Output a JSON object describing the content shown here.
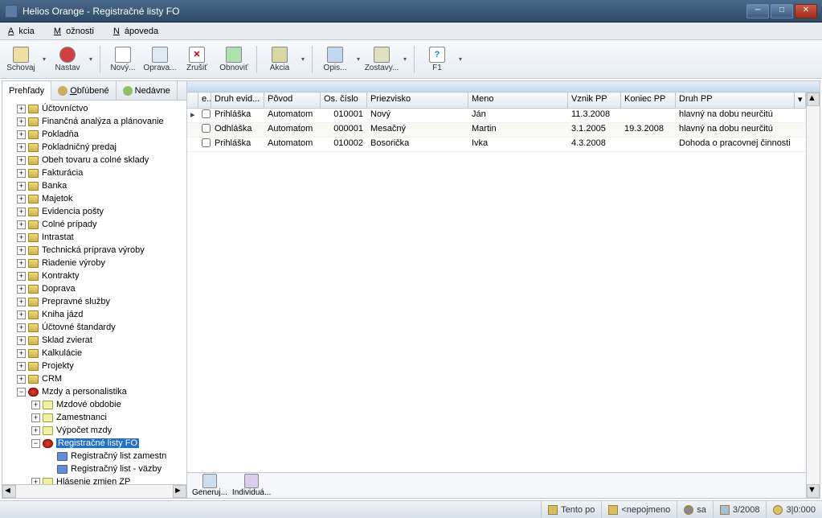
{
  "title": "Helios Orange - Registračné listy FO",
  "menu": {
    "akcia": "Akcia",
    "moznosti": "Možnosti",
    "napoveda": "Nápoveda"
  },
  "toolbar": {
    "schovaj": "Schovaj",
    "nastav": "Nastav",
    "novy": "Nový...",
    "oprava": "Oprava...",
    "zrusit": "Zrušiť",
    "obnovit": "Obnoviť",
    "akcia": "Akcia",
    "opis": "Opis...",
    "zostavy": "Zostavy...",
    "f1": "F1"
  },
  "side_tabs": {
    "prehlady": "Prehľady",
    "oblubene": "Obľúbené",
    "nedavne": "Nedávne"
  },
  "tree": {
    "uctovnictvo": "Účtovníctvo",
    "fap": "Finančná analýza a plánovanie",
    "pokladna": "Pokladňa",
    "pp": "Pokladničný predaj",
    "obeh": "Obeh tovaru a colné sklady",
    "fakt": "Fakturácia",
    "banka": "Banka",
    "majetok": "Majetok",
    "evidencia": "Evidencia pošty",
    "colne": "Colné prípady",
    "intrastat": "Intrastat",
    "tpv": "Technická príprava výroby",
    "riadenie": "Riadenie výroby",
    "kontrakty": "Kontrakty",
    "doprava": "Doprava",
    "prepravne": "Prepravné služby",
    "kniha": "Kniha jázd",
    "standardy": "Účtovné štandardy",
    "sklad": "Sklad zvierat",
    "kalk": "Kalkulácie",
    "projekty": "Projekty",
    "crm": "CRM",
    "mzdy": "Mzdy a personalistika",
    "mzdove": "Mzdové obdobie",
    "zamestnanci": "Zamestnanci",
    "vypocet": "Výpočet mzdy",
    "reg_fo": "Registračné listy FO",
    "reg_zam": "Registračný list zamestn",
    "reg_vazby": "Registračný list - väzby",
    "hlasenie": "Hlásenie zmien ZP"
  },
  "grid": {
    "headers": {
      "e": "e..",
      "druh_evid": "Druh evid...",
      "povod": "Pôvod",
      "os_cislo": "Os. číslo",
      "priezvisko": "Priezvisko",
      "meno": "Meno",
      "vznik": "Vznik PP",
      "koniec": "Koniec PP",
      "druh_pp": "Druh PP"
    },
    "rows": [
      {
        "druh": "Prihláška",
        "povod": "Automatom",
        "os": "010001",
        "priez": "Nový",
        "meno": "Ján",
        "vznik": "11.3.2008",
        "koniec": "",
        "druhpp": "hlavný na dobu neurčitú"
      },
      {
        "druh": "Odhláška",
        "povod": "Automatom",
        "os": "000001",
        "priez": "Mesačný",
        "meno": "Martin",
        "vznik": "3.1.2005",
        "koniec": "19.3.2008",
        "druhpp": "hlavný na dobu neurčitú"
      },
      {
        "druh": "Prihláška",
        "povod": "Automatom",
        "os": "010002",
        "priez": "Bosorička",
        "meno": "Ivka",
        "vznik": "4.3.2008",
        "koniec": "",
        "druhpp": "Dohoda o pracovnej činnosti"
      }
    ]
  },
  "bottom_buttons": {
    "generuj": "Generuj...",
    "individ": "Individuá..."
  },
  "status": {
    "tento": "Tento po",
    "nepojmeno": "<nepojmeno",
    "sa": "sa",
    "period": "3/2008",
    "counter": "3|0:000"
  }
}
